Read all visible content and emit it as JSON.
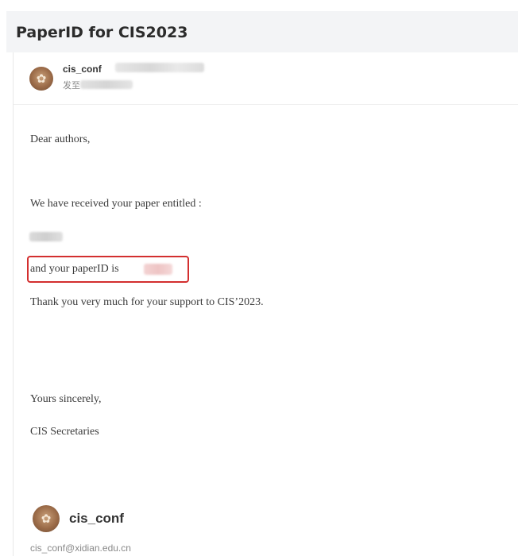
{
  "mail": {
    "subject": "PaperID for CIS2023",
    "sender": {
      "name": "cis_conf",
      "to_label": "发至"
    },
    "body": {
      "greeting": "Dear authors,",
      "received_line": "We have received your paper entitled :",
      "paperid_line": "and your paperID is",
      "thanks_line": "Thank you very much for your support to CIS’2023.",
      "closing": "Yours sincerely,",
      "signoff": "CIS Secretaries"
    },
    "signature": {
      "name": "cis_conf",
      "email": "cis_conf@xidian.edu.cn"
    }
  },
  "icons": {
    "sender_avatar": "avatar-icon",
    "signature_avatar": "avatar-icon"
  },
  "colors": {
    "highlight_border": "#d32f2f",
    "title_bar_bg": "#f3f4f6"
  }
}
